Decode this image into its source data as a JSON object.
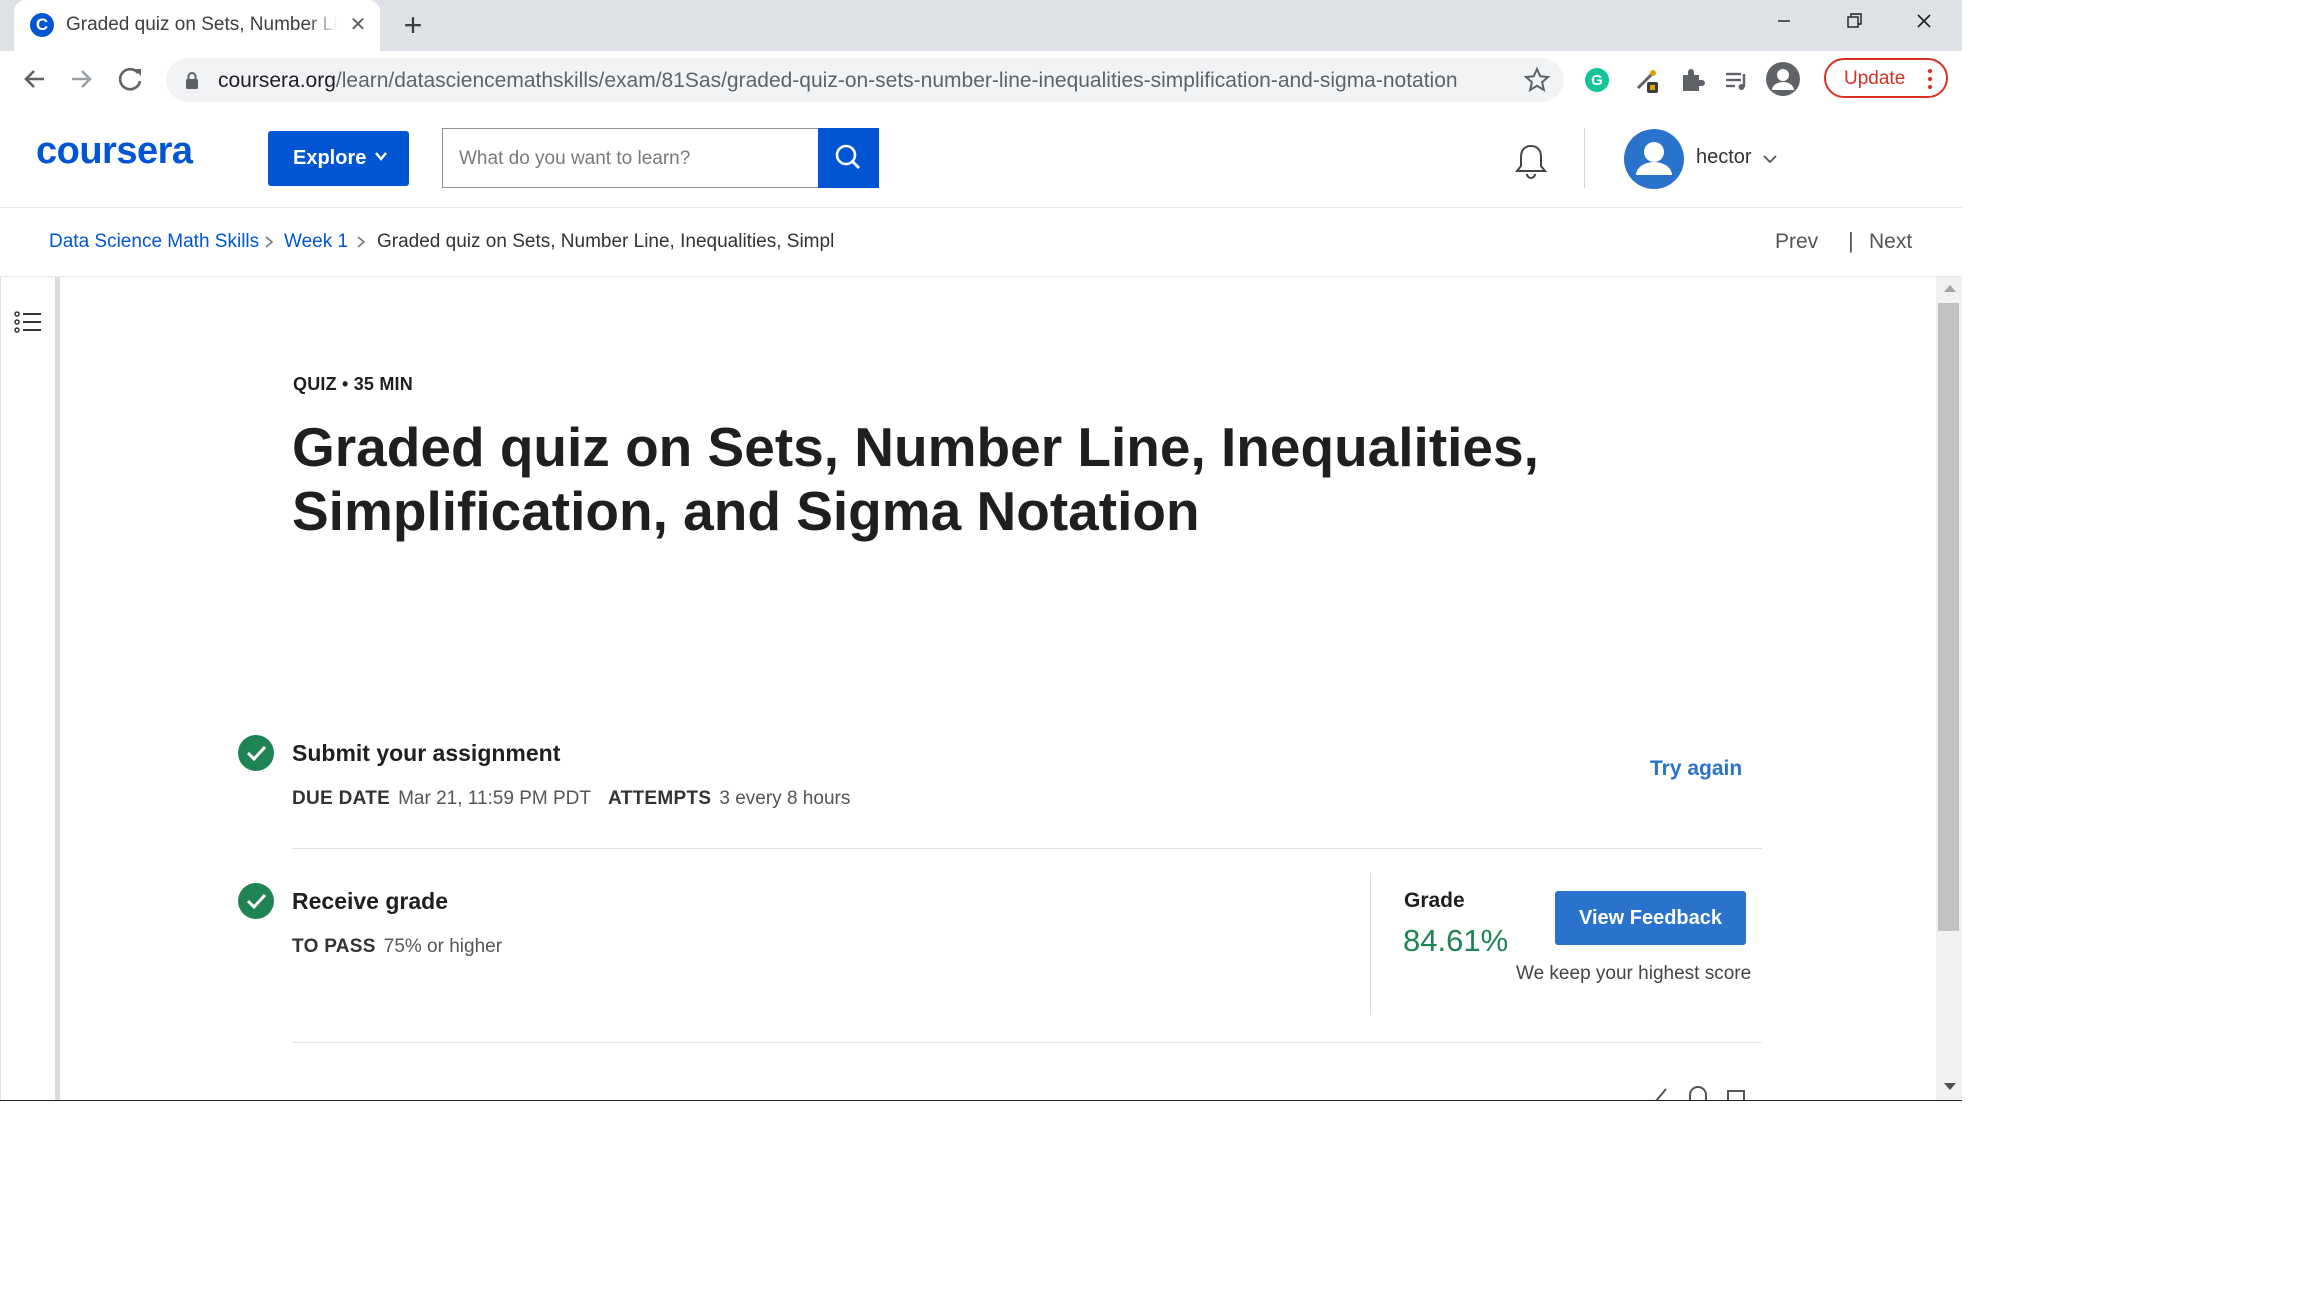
{
  "browser": {
    "tab": {
      "title": "Graded quiz on Sets, Number Line, Inequalities, Simplification, and Sigma Notation",
      "favicon": "coursera-favicon-icon"
    },
    "url": {
      "host": "coursera.org",
      "path": "/learn/datasciencemathskills/exam/81Sas/graded-quiz-on-sets-number-line-inequalities-simplification-and-sigma-notation"
    },
    "update_label": "Update",
    "extensions": [
      "grammarly-icon",
      "eyedropper-icon",
      "puzzle-icon",
      "media-queue-icon",
      "profile-icon"
    ]
  },
  "header": {
    "logo": "coursera",
    "explore_label": "Explore",
    "search_placeholder": "What do you want to learn?",
    "username": "hector"
  },
  "breadcrumb": {
    "items": [
      {
        "label": "Data Science Math Skills"
      },
      {
        "label": "Week 1"
      },
      {
        "label": "Graded quiz on Sets, Number Line, Inequalities, Simpl"
      }
    ],
    "prev_label": "Prev",
    "divider": "|",
    "next_label": "Next"
  },
  "quiz": {
    "meta": "QUIZ • 35 MIN",
    "title": "Graded quiz on Sets, Number Line, Inequalities, Simplification, and Sigma Notation",
    "submit": {
      "heading": "Submit your assignment",
      "due_key": "DUE DATE",
      "due_value": "Mar 21, 11:59 PM PDT",
      "attempts_key": "ATTEMPTS",
      "attempts_value": "3 every 8 hours",
      "try_again_label": "Try again"
    },
    "receive": {
      "heading": "Receive grade",
      "pass_key": "TO PASS",
      "pass_value": "75% or higher",
      "grade_label": "Grade",
      "grade_value": "84.61%",
      "view_feedback_label": "View Feedback",
      "keep_note": "We keep your highest score"
    }
  },
  "colors": {
    "brand": "#0056d2",
    "link": "#2a73cc",
    "success": "#1f8354",
    "update_red": "#d93025"
  }
}
